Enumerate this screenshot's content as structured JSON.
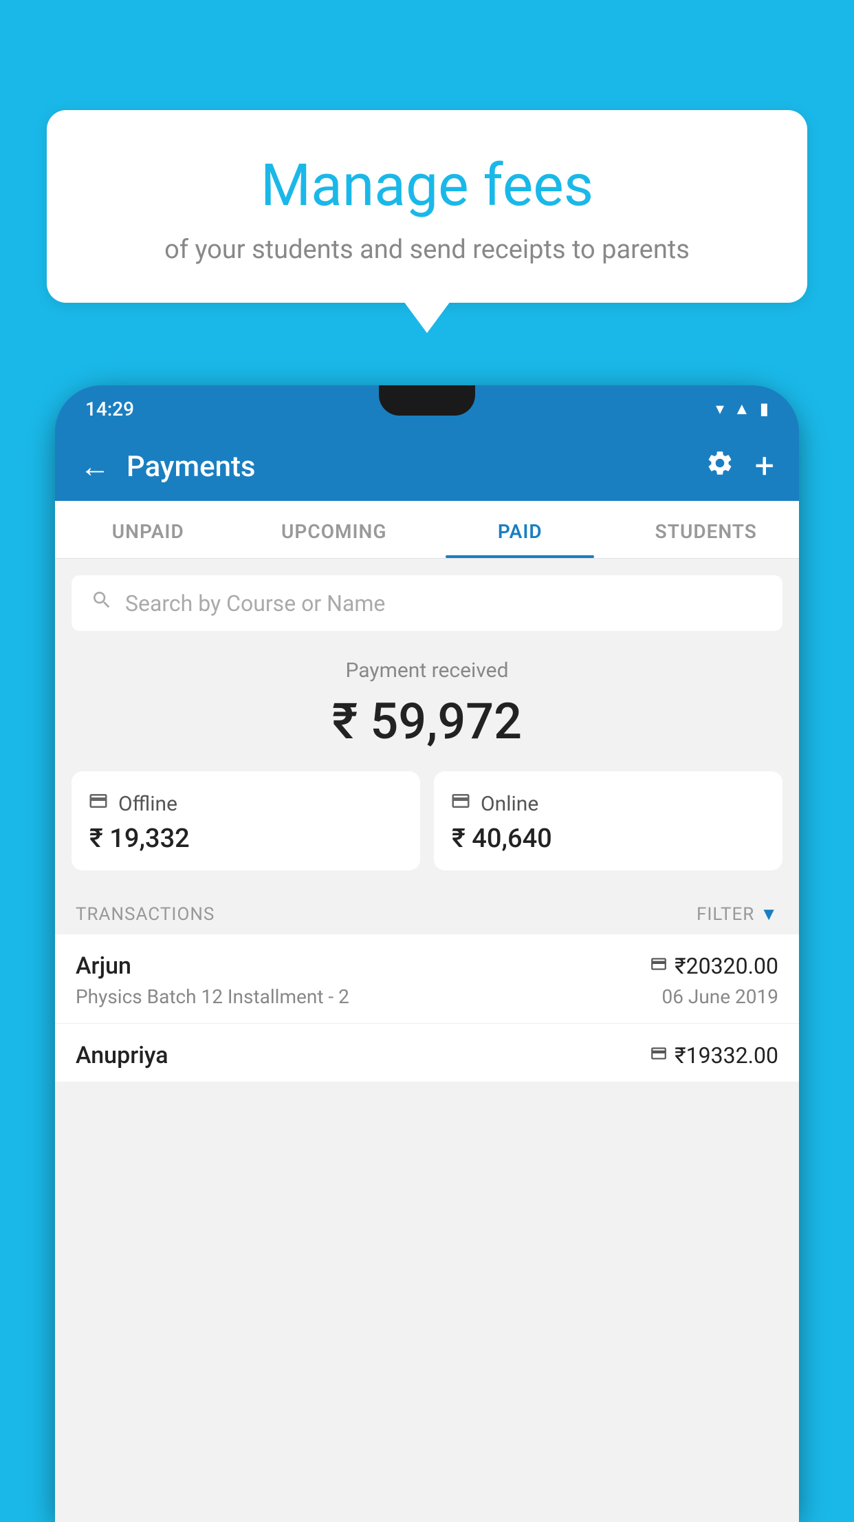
{
  "background_color": "#1ab8e8",
  "bubble": {
    "title": "Manage fees",
    "subtitle": "of your students and send receipts to parents"
  },
  "phone": {
    "status_bar": {
      "time": "14:29"
    },
    "toolbar": {
      "title": "Payments",
      "back_label": "←",
      "gear_label": "⚙",
      "plus_label": "+"
    },
    "tabs": [
      {
        "label": "UNPAID",
        "active": false
      },
      {
        "label": "UPCOMING",
        "active": false
      },
      {
        "label": "PAID",
        "active": true
      },
      {
        "label": "STUDENTS",
        "active": false
      }
    ],
    "search": {
      "placeholder": "Search by Course or Name"
    },
    "payment_received": {
      "label": "Payment received",
      "amount": "₹ 59,972"
    },
    "payment_cards": [
      {
        "type": "Offline",
        "amount": "₹ 19,332",
        "icon": "offline"
      },
      {
        "type": "Online",
        "amount": "₹ 40,640",
        "icon": "online"
      }
    ],
    "transactions_header": {
      "label": "TRANSACTIONS",
      "filter_label": "FILTER"
    },
    "transactions": [
      {
        "name": "Arjun",
        "description": "Physics Batch 12 Installment - 2",
        "amount": "₹20320.00",
        "date": "06 June 2019",
        "icon": "online"
      },
      {
        "name": "Anupriya",
        "description": "",
        "amount": "₹19332.00",
        "date": "",
        "icon": "offline"
      }
    ]
  }
}
